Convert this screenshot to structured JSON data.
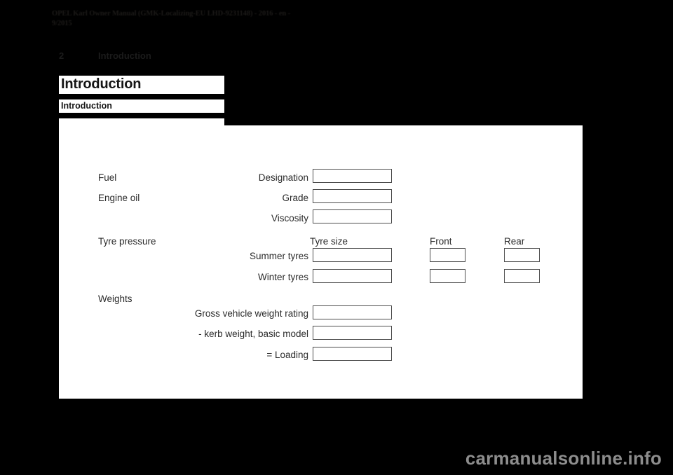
{
  "document": {
    "header_line_1": "OPEL Karl Owner Manual (GMK-Localizing-EU LHD-9231148) - 2016 - en -",
    "header_line_2": "9/2015",
    "running_head": {
      "page_number": "2",
      "section": "Introduction"
    },
    "title": "Introduction",
    "subtitle": "Introduction",
    "watermark": "carmanualsonline.info"
  },
  "form": {
    "sections": [
      {
        "name": "Fuel"
      },
      {
        "name": "Engine oil"
      },
      {
        "name": "Tyre pressure"
      },
      {
        "name": "Weights"
      }
    ],
    "fuel": {
      "designation_label": "Designation"
    },
    "engine_oil": {
      "grade_label": "Grade",
      "viscosity_label": "Viscosity"
    },
    "tyre_pressure": {
      "col_tyre_size": "Tyre size",
      "col_front": "Front",
      "col_rear": "Rear",
      "row_summer": "Summer tyres",
      "row_winter": "Winter tyres"
    },
    "weights": {
      "gross_label": "Gross vehicle weight rating",
      "kerb_label": "- kerb weight, basic model",
      "loading_label": "= Loading"
    }
  },
  "colors": {
    "page_background": "#000000",
    "paper": "#ffffff",
    "ink": "#1a1a1a",
    "box_border": "#4c4c4c",
    "watermark": "#8d8d8d"
  }
}
